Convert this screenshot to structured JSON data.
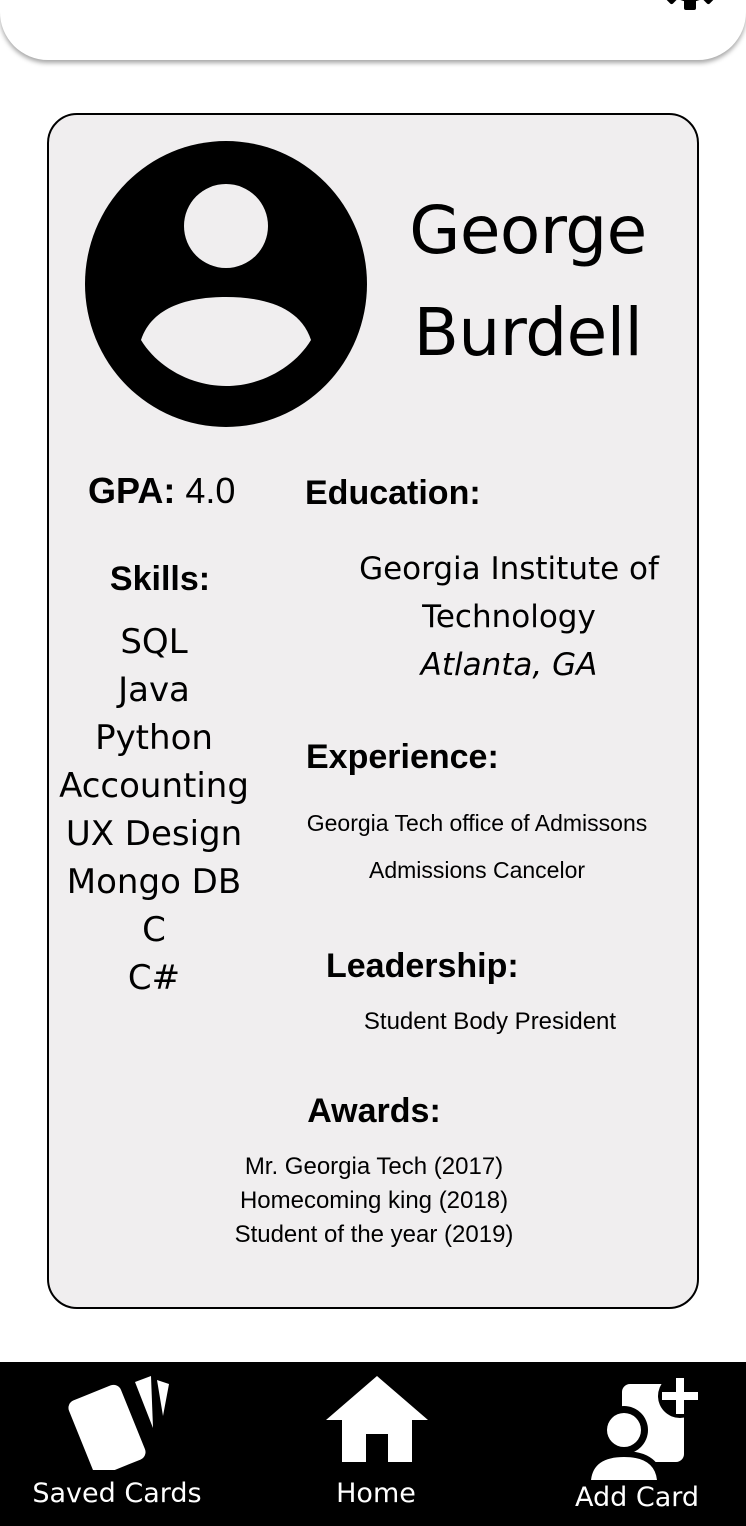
{
  "header": {
    "settings_icon": "gear-icon"
  },
  "profile": {
    "avatar_icon": "user-avatar-icon",
    "first_name": "George",
    "last_name": "Burdell"
  },
  "gpa": {
    "label": "GPA:",
    "value": "4.0"
  },
  "skills": {
    "heading": "Skills:",
    "items": [
      "SQL",
      "Java",
      "Python",
      "Accounting",
      "UX Design",
      "Mongo DB",
      "C",
      "C#"
    ]
  },
  "education": {
    "heading": "Education:",
    "school_line1": "Georgia Institute of",
    "school_line2": "Technology",
    "location": "Atlanta, GA"
  },
  "experience": {
    "heading": "Experience:",
    "items": [
      "Georgia Tech office of Admissons",
      "Admissions Cancelor"
    ]
  },
  "leadership": {
    "heading": "Leadership:",
    "items": [
      "Student Body President"
    ]
  },
  "awards": {
    "heading": "Awards:",
    "items": [
      "Mr. Georgia Tech (2017)",
      "Homecoming king (2018)",
      "Student of the year (2019)"
    ]
  },
  "nav": {
    "saved_label": "Saved Cards",
    "home_label": "Home",
    "add_label": "Add Card",
    "saved_icon": "cards-icon",
    "home_icon": "home-icon",
    "add_icon": "add-user-icon"
  },
  "colors": {
    "card_background": "#f0eeef",
    "nav_background": "#000000",
    "text": "#000000",
    "nav_text": "#ffffff"
  }
}
